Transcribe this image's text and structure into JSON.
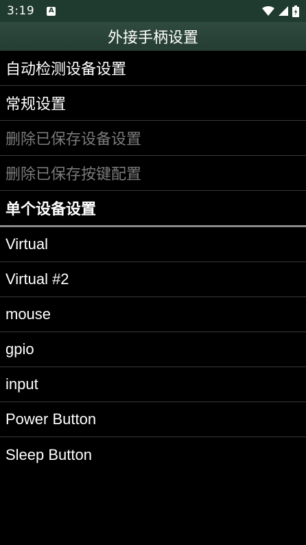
{
  "status": {
    "time": "3:19",
    "notif_letter": "A"
  },
  "title": "外接手柄设置",
  "settings": [
    {
      "label": "自动检测设备设置",
      "enabled": true
    },
    {
      "label": "常规设置",
      "enabled": true
    },
    {
      "label": "删除已保存设备设置",
      "enabled": false
    },
    {
      "label": "删除已保存按键配置",
      "enabled": false
    }
  ],
  "section_header": "单个设备设置",
  "devices": [
    "Virtual",
    "Virtual #2",
    "mouse",
    "gpio",
    "input",
    "Power Button",
    "Sleep Button"
  ],
  "colors": {
    "status_bar": "#1f3a2e",
    "title_bar": "#2a4438",
    "disabled_text": "#7a7a7a"
  }
}
